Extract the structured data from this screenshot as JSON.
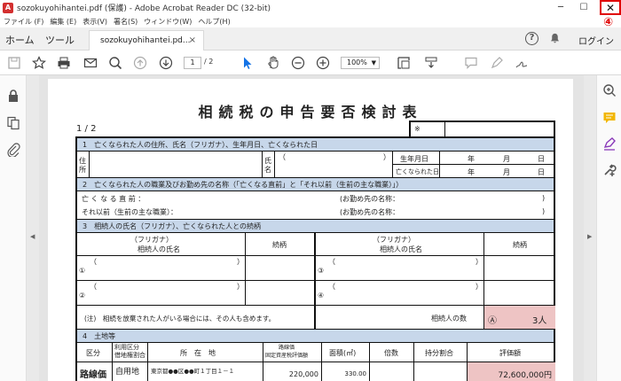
{
  "window": {
    "title": "sozokuyohihantei.pdf (保護) - Adobe Acrobat Reader DC (32-bit)",
    "minimize": "─",
    "maximize": "☐",
    "close": "✕",
    "annotation": "④"
  },
  "menu": [
    "ファイル (F)",
    "編集 (E)",
    "表示(V)",
    "署名(S)",
    "ウィンドウ(W)",
    "ヘルプ(H)"
  ],
  "tabs": {
    "home": "ホーム",
    "tools": "ツール",
    "document": "sozokuyohihantei.pd...",
    "document_close": "×",
    "help": "?",
    "login": "ログイン"
  },
  "toolbar": {
    "page_current": "1",
    "page_total": "/ 2",
    "zoom": "100%"
  },
  "document": {
    "title": "相続税の申告要否検討表",
    "page_label": "1 / 2",
    "stamp_mark": "※",
    "section1": {
      "heading": "1　亡くなられた人の住所、氏名（フリガナ）、生年月日、亡くなられた日",
      "address_label": "住所",
      "name_label": "氏名",
      "paren_open": "（",
      "paren_close": "）",
      "birth_label": "生年月日",
      "death_label": "亡くなられた日",
      "year": "年",
      "month": "月",
      "day": "日"
    },
    "section2": {
      "heading": "2　亡くなられた人の職業及びお勤め先の名称（「亡くなる直前」と「それ以前（生前の主な職業）」）",
      "row1_label": "亡 く な る 直 前 ：",
      "row2_label": "それ以前（生前の主な職業）：",
      "employer_label": "(お勤め先の名称：",
      "close_paren": ")"
    },
    "section3": {
      "heading": "3　相続人の氏名（フリガナ）、亡くなられた人との続柄",
      "col_name_line1": "（フリガナ）",
      "col_name_line2": "相続人の氏名",
      "col_relation": "続柄",
      "num1": "①",
      "num2": "②",
      "num3": "③",
      "num4": "④",
      "paren_open": "（",
      "paren_close": "）",
      "note": "(注)　相続を放棄された人がいる場合には、その人も含めます。",
      "heirs_count_label": "相続人の数",
      "heirs_mark": "Ⓐ",
      "heirs_count": "3人"
    },
    "section4": {
      "heading": "4　土地等",
      "cols": [
        "区分",
        "利用区分\n借地権割合",
        "所　在　地",
        "路線価\n固定資産税評価額",
        "面積(㎡)",
        "倍数",
        "持分割合",
        "評価額"
      ],
      "row": {
        "kubun": "路線価",
        "usage": "自用地",
        "location": "東京都●●区●●町１丁目１－１",
        "rosenka": "220,000",
        "area": "330.00",
        "value": "72,600,000円"
      }
    }
  }
}
